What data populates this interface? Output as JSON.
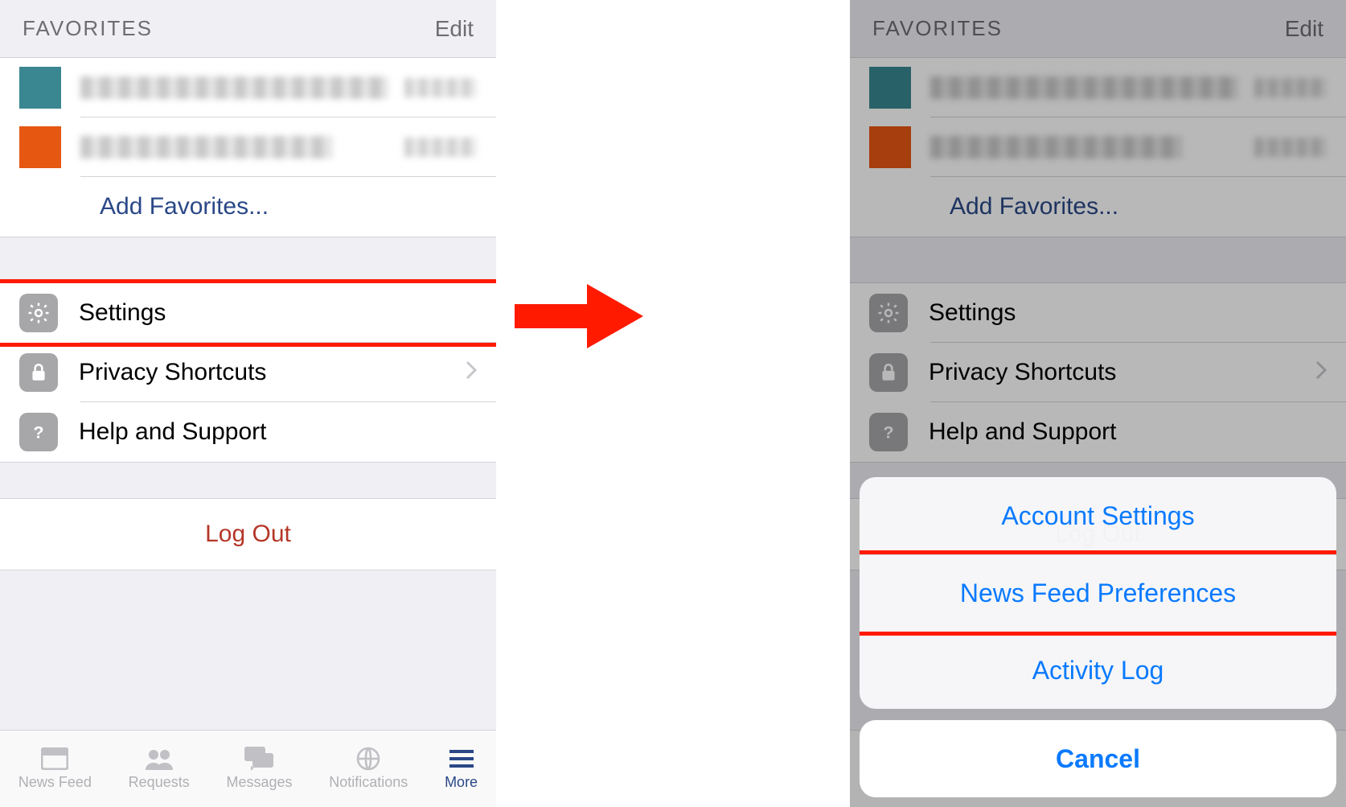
{
  "section": {
    "title": "FAVORITES",
    "edit": "Edit"
  },
  "addFavorites": "Add Favorites...",
  "menu": {
    "settings": "Settings",
    "privacy": "Privacy Shortcuts",
    "help": "Help and Support"
  },
  "logout": "Log Out",
  "tabs": {
    "newsFeed": "News Feed",
    "requests": "Requests",
    "messages": "Messages",
    "notifications": "Notifications",
    "more": "More"
  },
  "sheet": {
    "accountSettings": "Account Settings",
    "newsFeedPrefs": "News Feed Preferences",
    "activityLog": "Activity Log",
    "cancel": "Cancel"
  },
  "colors": {
    "highlight": "#ff1a00",
    "link": "#0a7aff",
    "accent": "#2a4887"
  }
}
